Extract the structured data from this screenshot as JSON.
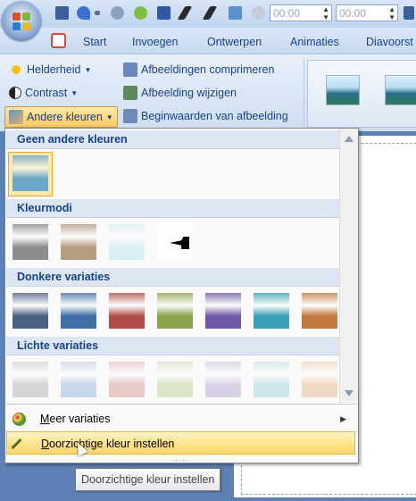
{
  "quick_access": {
    "time_start": "00:00",
    "time_end": "00:00",
    "icons": [
      "save-icon",
      "undo-icon",
      "redo-icon",
      "circle-icon",
      "picture-icon",
      "pen-icon",
      "pen-icon",
      "image-icon",
      "circle-icon"
    ]
  },
  "tabs": [
    "Start",
    "Invoegen",
    "Ontwerpen",
    "Animaties",
    "Diavoorst"
  ],
  "ribbon": {
    "adjust_left": [
      {
        "label": "Helderheid",
        "icon": "sun-icon"
      },
      {
        "label": "Contrast",
        "icon": "contrast-icon"
      },
      {
        "label": "Andere kleuren",
        "icon": "recolor-icon"
      }
    ],
    "adjust_right": [
      {
        "label": "Afbeeldingen comprimeren",
        "icon": "compress-icon"
      },
      {
        "label": "Afbeelding wijzigen",
        "icon": "change-picture-icon"
      },
      {
        "label": "Beginwaarden van afbeelding",
        "icon": "reset-picture-icon"
      }
    ]
  },
  "menu": {
    "sections": [
      {
        "title": "Geen andere kleuren",
        "swatches": [
          "#6aa7c9"
        ]
      },
      {
        "title": "Kleurmodi",
        "swatches": [
          "#8c8c8c",
          "#b59d82",
          "#dbeef5",
          "#000000"
        ]
      },
      {
        "title": "Donkere variaties",
        "swatches": [
          "#4a6183",
          "#3f6fa6",
          "#b04b47",
          "#8aa24a",
          "#7058a6",
          "#3aa0b6",
          "#c2793d"
        ]
      },
      {
        "title": "Lichte variaties",
        "swatches": [
          "#d5d5d5",
          "#c9d7ea",
          "#e7c9c6",
          "#dbe4c8",
          "#d9d1e6",
          "#cde6ec",
          "#f0d9c4"
        ]
      }
    ],
    "items": [
      {
        "label": "Meer variaties",
        "icon": "palette-icon"
      },
      {
        "label": "Doorzichtige kleur instellen",
        "icon": "eyedropper-icon"
      }
    ]
  },
  "tooltip": "Doorzichtige kleur instellen",
  "colors": {
    "accent_highlight": "#fcd46a",
    "ribbon_text": "#15428b",
    "slide_bg": "#5d81b5"
  }
}
